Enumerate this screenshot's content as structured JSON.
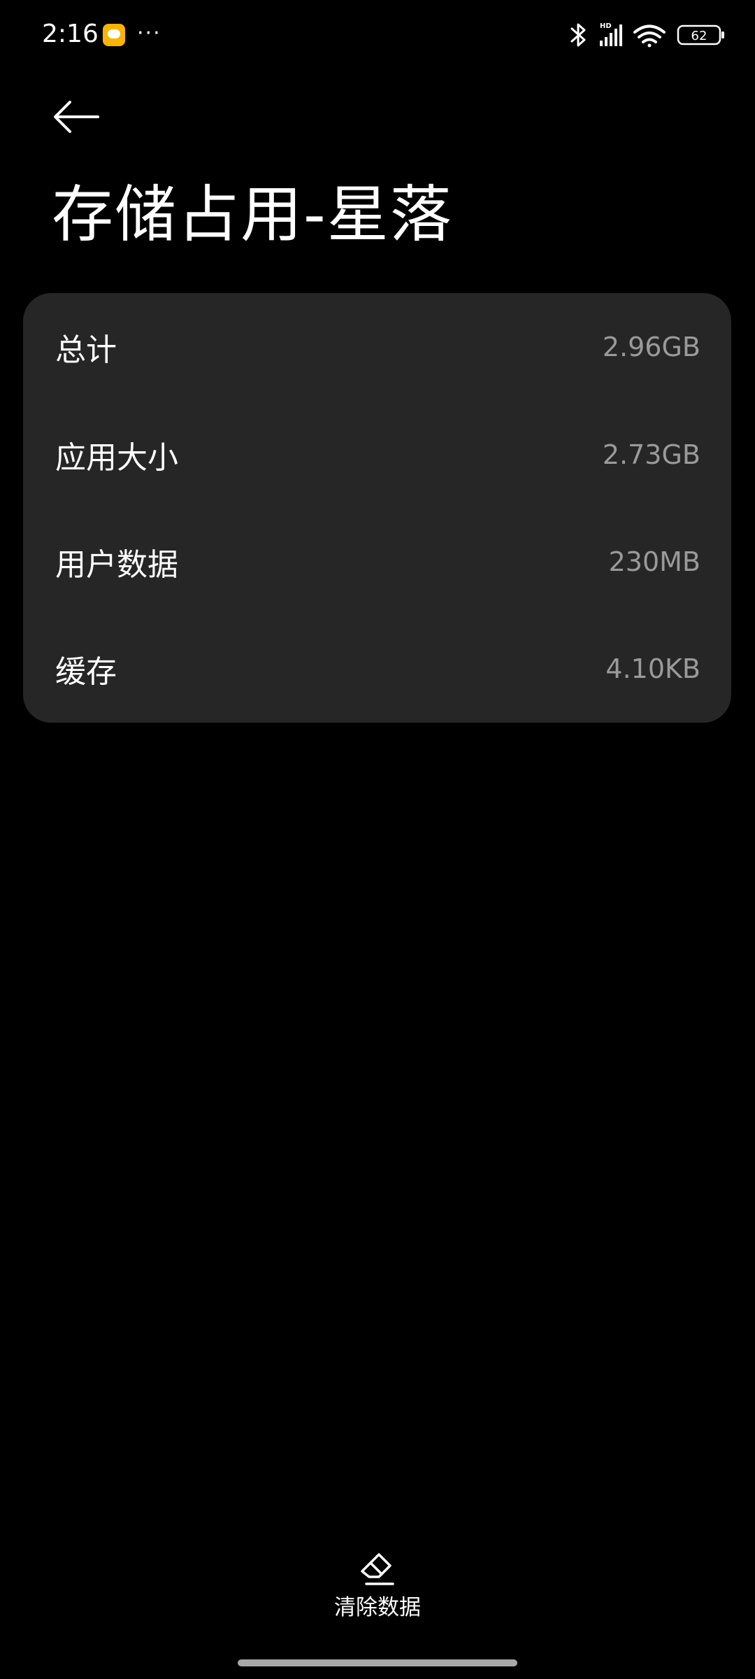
{
  "status_bar": {
    "time": "2:16",
    "more": "···",
    "signal_badge": "HD",
    "battery": "62",
    "icons": [
      "message-icon",
      "bluetooth-icon",
      "signal-icon",
      "wifi-icon",
      "battery-icon"
    ]
  },
  "header": {
    "title": "存储占用-星落"
  },
  "storage": {
    "rows": [
      {
        "label": "总计",
        "value": "2.96GB"
      },
      {
        "label": "应用大小",
        "value": "2.73GB"
      },
      {
        "label": "用户数据",
        "value": "230MB"
      },
      {
        "label": "缓存",
        "value": "4.10KB"
      }
    ]
  },
  "actions": {
    "clear_data_label": "清除数据"
  },
  "colors": {
    "background": "#000000",
    "card": "#262626",
    "value_text": "#9a9a9a",
    "notification": "#f7b500"
  }
}
